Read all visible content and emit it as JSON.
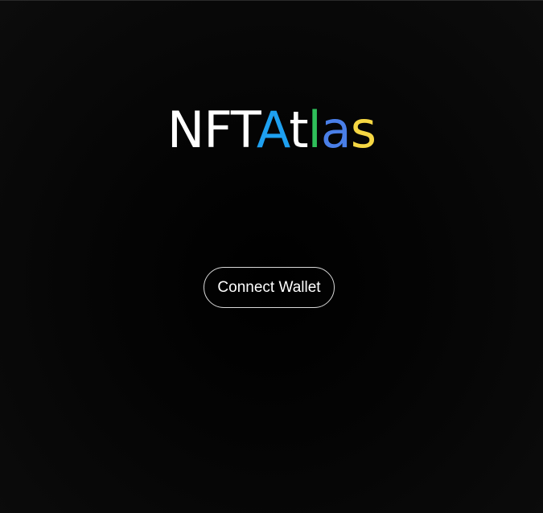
{
  "logo": {
    "parts": [
      {
        "text": "NFT",
        "color": "#ffffff"
      },
      {
        "text": "A",
        "color": "#1ea0f0"
      },
      {
        "text": "t",
        "color": "#ffffff"
      },
      {
        "text": "l",
        "color": "#2fbf5a"
      },
      {
        "text": "a",
        "color": "#4a7fe8"
      },
      {
        "text": "s",
        "color": "#f6d743"
      }
    ]
  },
  "connect_button": {
    "label": "Connect Wallet"
  }
}
